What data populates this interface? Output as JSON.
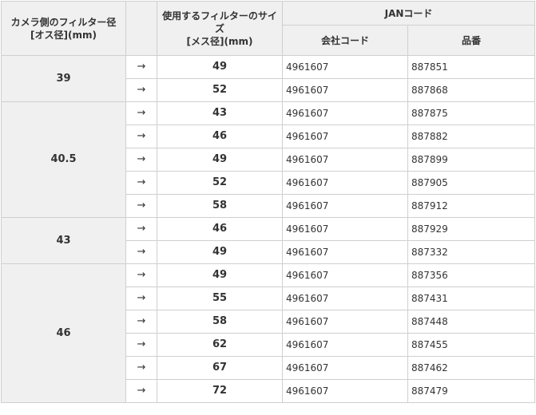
{
  "headers": {
    "camera_filter": "カメラ側のフィルター径",
    "camera_filter_unit": "[オス径](mm)",
    "use_filter": "使用するフィルターのサイズ",
    "use_filter_unit": "[メス径](mm)",
    "jan": "JANコード",
    "company_code": "会社コード",
    "item_number": "品番"
  },
  "arrow": "→",
  "groups": [
    {
      "camera": "39",
      "rows": [
        {
          "size": "49",
          "company": "4961607",
          "item": "887851"
        },
        {
          "size": "52",
          "company": "4961607",
          "item": "887868"
        }
      ]
    },
    {
      "camera": "40.5",
      "rows": [
        {
          "size": "43",
          "company": "4961607",
          "item": "887875"
        },
        {
          "size": "46",
          "company": "4961607",
          "item": "887882"
        },
        {
          "size": "49",
          "company": "4961607",
          "item": "887899"
        },
        {
          "size": "52",
          "company": "4961607",
          "item": "887905"
        },
        {
          "size": "58",
          "company": "4961607",
          "item": "887912"
        }
      ]
    },
    {
      "camera": "43",
      "rows": [
        {
          "size": "46",
          "company": "4961607",
          "item": "887929"
        },
        {
          "size": "49",
          "company": "4961607",
          "item": "887332"
        }
      ]
    },
    {
      "camera": "46",
      "rows": [
        {
          "size": "49",
          "company": "4961607",
          "item": "887356"
        },
        {
          "size": "55",
          "company": "4961607",
          "item": "887431"
        },
        {
          "size": "58",
          "company": "4961607",
          "item": "887448"
        },
        {
          "size": "62",
          "company": "4961607",
          "item": "887455"
        },
        {
          "size": "67",
          "company": "4961607",
          "item": "887462"
        },
        {
          "size": "72",
          "company": "4961607",
          "item": "887479"
        }
      ]
    }
  ]
}
